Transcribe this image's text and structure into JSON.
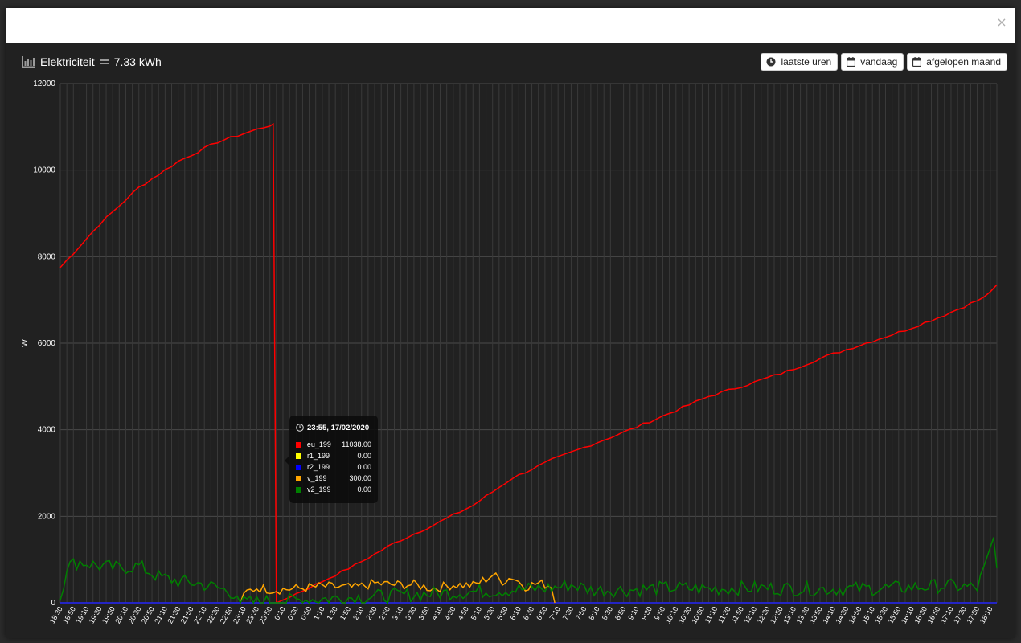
{
  "dialog": {
    "close_label": "×"
  },
  "header": {
    "title": "Elektriciteit",
    "total": "7.33 kWh"
  },
  "buttons": [
    {
      "label": "laatste uren",
      "icon": "clock-icon"
    },
    {
      "label": "vandaag",
      "icon": "calendar-icon"
    },
    {
      "label": "afgelopen maand",
      "icon": "calendar-icon"
    }
  ],
  "tooltip": {
    "time": "23:55, 17/02/2020",
    "rows": [
      {
        "name": "eu_199",
        "value": "11038.00",
        "color": "#ff0000"
      },
      {
        "name": "r1_199",
        "value": "0.00",
        "color": "#ffff00"
      },
      {
        "name": "r2_199",
        "value": "0.00",
        "color": "#0000ff"
      },
      {
        "name": "v_199",
        "value": "300.00",
        "color": "#ffa500"
      },
      {
        "name": "v2_199",
        "value": "0.00",
        "color": "#008000"
      }
    ]
  },
  "chart_data": {
    "type": "line",
    "title": "",
    "ylabel": "W",
    "xlabel": "",
    "ylim": [
      0,
      12000
    ],
    "yticks": [
      0,
      2000,
      4000,
      6000,
      8000,
      10000,
      12000
    ],
    "xticks": [
      "18:30",
      "18:50",
      "19:10",
      "19:30",
      "19:50",
      "20:10",
      "20:30",
      "20:50",
      "21:10",
      "21:30",
      "21:50",
      "22:10",
      "22:30",
      "22:50",
      "23:10",
      "23:30",
      "23:50",
      "0:10",
      "0:30",
      "0:50",
      "1:10",
      "1:30",
      "1:50",
      "2:10",
      "2:30",
      "2:50",
      "3:10",
      "3:30",
      "3:50",
      "4:10",
      "4:30",
      "4:50",
      "5:10",
      "5:30",
      "5:50",
      "6:10",
      "6:30",
      "6:50",
      "7:10",
      "7:30",
      "7:50",
      "8:10",
      "8:30",
      "8:50",
      "9:10",
      "9:30",
      "9:50",
      "10:10",
      "10:30",
      "10:50",
      "11:10",
      "11:30",
      "11:50",
      "12:10",
      "12:30",
      "12:50",
      "13:10",
      "13:30",
      "13:50",
      "14:10",
      "14:30",
      "14:50",
      "15:10",
      "15:30",
      "15:50",
      "16:10",
      "16:30",
      "16:50",
      "17:10",
      "17:30",
      "17:50",
      "18:10"
    ],
    "grid": true,
    "legend": "none",
    "series": [
      {
        "name": "eu_199",
        "color": "#ff0000",
        "x": [
          "18:30",
          "19:30",
          "20:30",
          "21:30",
          "22:30",
          "23:50",
          "23:55",
          "0:00",
          "1:00",
          "2:00",
          "3:00",
          "4:00",
          "5:00",
          "6:00",
          "7:00",
          "8:00",
          "9:00",
          "10:00",
          "11:00",
          "12:00",
          "13:00",
          "14:00",
          "15:00",
          "16:00",
          "17:00",
          "18:00",
          "18:20"
        ],
        "values": [
          7750,
          8750,
          9600,
          10200,
          10650,
          11038,
          11038,
          0,
          420,
          870,
          1380,
          1800,
          2250,
          2880,
          3300,
          3650,
          4000,
          4380,
          4770,
          5050,
          5350,
          5700,
          6000,
          6300,
          6650,
          7050,
          7350
        ]
      },
      {
        "name": "r1_199",
        "color": "#ffff00",
        "values_const": 0
      },
      {
        "name": "r2_199",
        "color": "#0000ff",
        "values_const": 0
      },
      {
        "name": "v_199",
        "color": "#ffa500",
        "x": [
          "23:05",
          "23:15",
          "23:30",
          "23:55",
          "0:30",
          "1:10",
          "2:00",
          "2:30",
          "3:00",
          "3:30",
          "4:00",
          "4:30",
          "5:00",
          "5:20",
          "5:30",
          "5:45",
          "6:00",
          "6:20",
          "6:40",
          "7:00",
          "7:05"
        ],
        "values": [
          0,
          250,
          350,
          300,
          330,
          380,
          350,
          450,
          420,
          420,
          330,
          420,
          400,
          550,
          650,
          500,
          600,
          380,
          450,
          400,
          0
        ]
      },
      {
        "name": "v2_199",
        "color": "#008000",
        "x": [
          "18:30",
          "18:40",
          "19:00",
          "19:30",
          "20:00",
          "20:30",
          "21:00",
          "21:30",
          "22:00",
          "22:30",
          "23:00",
          "23:05",
          "7:05",
          "7:30",
          "8:00",
          "9:00",
          "10:00",
          "11:00",
          "12:00",
          "13:00",
          "14:00",
          "15:00",
          "16:00",
          "17:00",
          "17:50",
          "18:05",
          "18:15",
          "18:20"
        ],
        "values": [
          100,
          850,
          950,
          850,
          800,
          850,
          600,
          500,
          450,
          350,
          200,
          0,
          350,
          420,
          300,
          300,
          350,
          320,
          350,
          330,
          320,
          330,
          350,
          400,
          350,
          950,
          1450,
          800
        ]
      }
    ]
  }
}
